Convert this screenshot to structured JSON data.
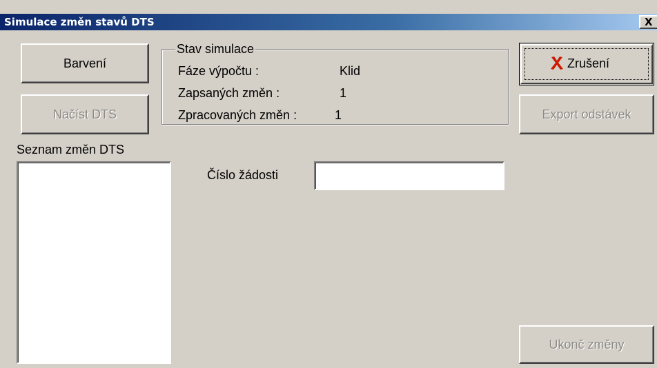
{
  "window": {
    "title": "Simulace změn stavů DTS",
    "close_label": "X"
  },
  "buttons": {
    "coloring": "Barvení",
    "load_dts": "Načíst DTS",
    "cancel": "Zrušení",
    "export_outages": "Export odstávek",
    "finish_changes": "Ukonč změny"
  },
  "simulation_state": {
    "legend": "Stav simulace",
    "phase_label": "Fáze výpočtu :",
    "phase_value": "Klid",
    "written_label": "Zapsaných změn :",
    "written_value": "1",
    "processed_label": "Zpracovaných změn :",
    "processed_value": "1"
  },
  "changes_list": {
    "label": "Seznam změn DTS",
    "items": []
  },
  "request": {
    "label": "Číslo žádosti",
    "value": ""
  },
  "icons": {
    "cancel": "red-x-icon"
  },
  "colors": {
    "title_start": "#0a246a",
    "title_end": "#a6caf0",
    "cancel_icon": "#cc1a00"
  }
}
